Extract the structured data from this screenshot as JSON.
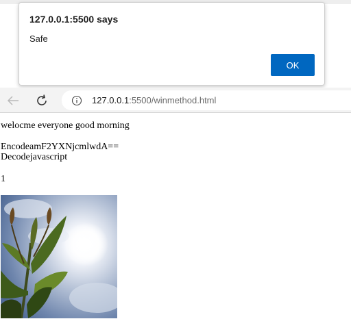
{
  "dialog": {
    "title": "127.0.0.1:5500 says",
    "message": "Safe",
    "ok_label": "OK"
  },
  "browser": {
    "url_host": "127.0.0.1",
    "url_rest": ":5500/winmethod.html"
  },
  "page": {
    "greeting": "welocme everyone good morning",
    "encode_line": "EncodeamF2YXNjcmlwdA==",
    "decode_line": "Decodejavascript",
    "count_line": "1"
  },
  "icons": {
    "back": "back-arrow-icon",
    "reload": "reload-icon",
    "info": "info-icon"
  },
  "colors": {
    "ok_button": "#0067c0",
    "toolbar_bg": "#f3f3f3"
  }
}
